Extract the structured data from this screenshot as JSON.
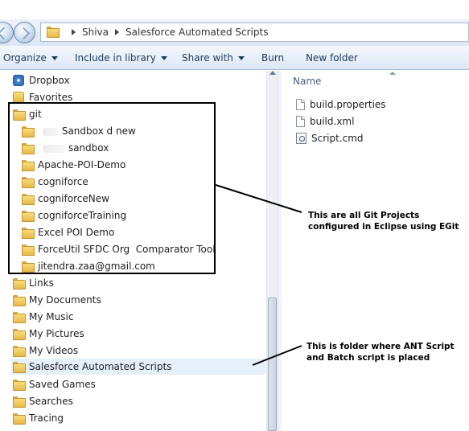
{
  "address_bar": {
    "crumbs": [
      "Shiva",
      "Salesforce Automated Scripts"
    ]
  },
  "toolbar": {
    "organize": "Organize",
    "include_in_library": "Include in library",
    "share_with": "Share with",
    "burn": "Burn",
    "new_folder": "New folder"
  },
  "nav_tree": {
    "items": [
      {
        "label": "Dropbox",
        "icon": "dropbox-icon"
      },
      {
        "label": "Favorites",
        "icon": "favorites-icon"
      },
      {
        "label": "git",
        "icon": "folder-icon"
      },
      {
        "label": "Sandbox d   new",
        "icon": "folder-icon"
      },
      {
        "label": "sandbox",
        "icon": "folder-icon"
      },
      {
        "label": "Apache-POI-Demo",
        "icon": "folder-icon"
      },
      {
        "label": "cogniforce",
        "icon": "folder-icon"
      },
      {
        "label": "cogniforceNew",
        "icon": "folder-icon"
      },
      {
        "label": "cogniforceTraining",
        "icon": "folder-icon"
      },
      {
        "label": "Excel POI Demo",
        "icon": "folder-icon"
      },
      {
        "label": "ForceUtil SFDC Org  Comparator Tool",
        "icon": "folder-icon"
      },
      {
        "label": "jitendra.zaa@gmail.com",
        "icon": "folder-icon"
      },
      {
        "label": "Links",
        "icon": "folder-icon"
      },
      {
        "label": "My Documents",
        "icon": "folder-icon"
      },
      {
        "label": "My Music",
        "icon": "folder-icon"
      },
      {
        "label": "My Pictures",
        "icon": "folder-icon"
      },
      {
        "label": "My Videos",
        "icon": "folder-icon"
      },
      {
        "label": "Salesforce Automated Scripts",
        "icon": "folder-icon"
      },
      {
        "label": "Saved Games",
        "icon": "folder-icon"
      },
      {
        "label": "Searches",
        "icon": "folder-icon"
      },
      {
        "label": "Tracing",
        "icon": "folder-icon"
      }
    ]
  },
  "content": {
    "column_name": "Name",
    "files": [
      {
        "label": "build.properties",
        "icon": "file-icon"
      },
      {
        "label": "build.xml",
        "icon": "file-icon"
      },
      {
        "label": "Script.cmd",
        "icon": "cmd-file-icon"
      }
    ]
  },
  "annotations": {
    "git_note": "This are all Git Projects configured in Eclipse using EGit",
    "folder_note": "This is folder where ANT Script and Batch script is placed"
  },
  "colors": {
    "toolbar_text": "#1e395b",
    "selected_row": "#e5f0fb",
    "folder": "#e7b94a"
  }
}
